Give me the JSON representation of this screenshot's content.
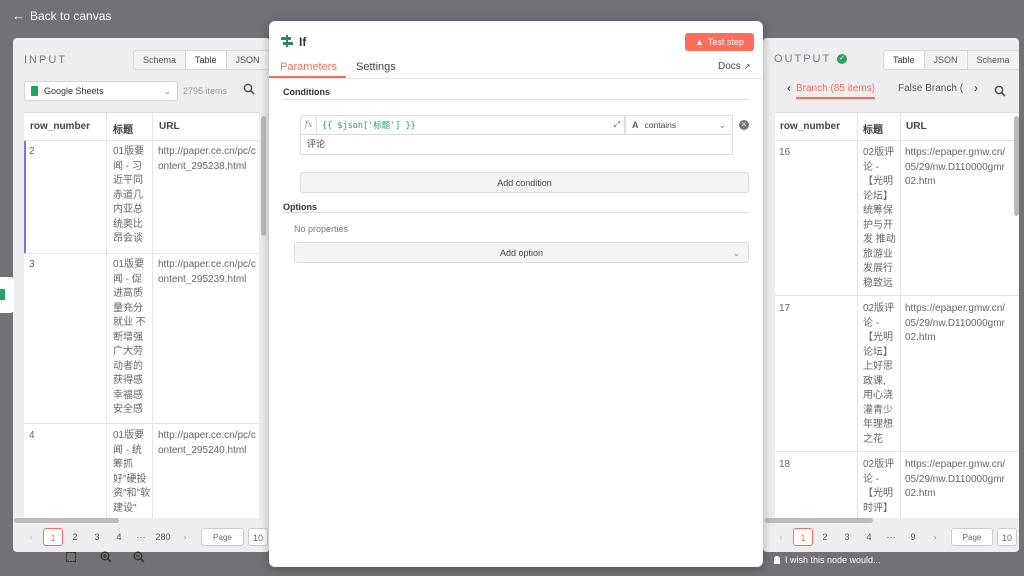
{
  "back_label": "Back to canvas",
  "input": {
    "title": "INPUT",
    "tabs": [
      "Schema",
      "Table",
      "JSON"
    ],
    "active_tab": "Table",
    "source_name": "Google Sheets",
    "item_count": "2795 items",
    "columns": [
      "row_number",
      "标题",
      "URL"
    ],
    "rows": [
      {
        "row_number": "2",
        "title": "01版要\n闻 - 习\n近平同\n赤道几\n内亚总\n统奥比\n昂会谈",
        "url": "http://paper.ce.cn/pc/c\nontent_295238.html"
      },
      {
        "row_number": "3",
        "title": "01版要\n闻 - 促\n进高质\n量充分\n就业 不\n断增强\n广大劳\n动者的\n获得感\n幸福感\n安全感",
        "url": "http://paper.ce.cn/pc/c\nontent_295239.html"
      },
      {
        "row_number": "4",
        "title": "01版要\n闻 - 统\n筹抓\n好\"硬投\n资\"和\"软\n建设\"",
        "url": "http://paper.ce.cn/pc/c\nontent_295240.html"
      }
    ],
    "pages": [
      "1",
      "2",
      "3",
      "4",
      "···",
      "280"
    ],
    "current_page": "1",
    "page_size_label": "Page Size",
    "page_size_value": "10"
  },
  "modal": {
    "node_name": "If",
    "test_step_label": "Test step",
    "tabs": [
      "Parameters",
      "Settings"
    ],
    "active_tab": "Parameters",
    "docs_label": "Docs",
    "conditions_title": "Conditions",
    "condition": {
      "left_value": "{{ $json['标题'] }}",
      "operator": "contains",
      "right_value": "评论",
      "fx_label": "fx"
    },
    "add_condition_label": "Add condition",
    "options_title": "Options",
    "no_properties_label": "No properties",
    "add_option_label": "Add option"
  },
  "output": {
    "title": "OUTPUT",
    "tabs": [
      "Table",
      "JSON",
      "Schema"
    ],
    "active_tab": "Table",
    "branch_true_label": "Branch (85 items)",
    "branch_false_label": "False Branch (",
    "columns": [
      "row_number",
      "标题",
      "URL"
    ],
    "rows": [
      {
        "row_number": "16",
        "title": "02版评\n论 -\n【光明\n论坛】\n统筹保\n护与开\n发 推动\n旅游业\n发展行\n稳致远",
        "url": "https://epaper.gmw.cn/\n05/29/nw.D110000gmr\n02.htm"
      },
      {
        "row_number": "17",
        "title": "02版评\n论 -\n【光明\n论坛】\n上好思\n政课,\n用心浇\n灌青少\n年理想\n之花",
        "url": "https://epaper.gmw.cn/\n05/29/nw.D110000gmr\n02.htm"
      },
      {
        "row_number": "18",
        "title": "02版评\n论 -\n【光明\n时评】",
        "url": "https://epaper.gmw.cn/\n05/29/nw.D110000gmr\n02.htm"
      }
    ],
    "pages": [
      "1",
      "2",
      "3",
      "4",
      "···",
      "9"
    ],
    "current_page": "1",
    "page_size_label": "Page Size",
    "page_size_value": "10"
  },
  "feedback_label": "I wish this node would...",
  "colors": {
    "accent": "#ff6d5a",
    "success": "#29a35a",
    "sheets_green": "#1fa463",
    "if_green": "#2e8b57"
  }
}
